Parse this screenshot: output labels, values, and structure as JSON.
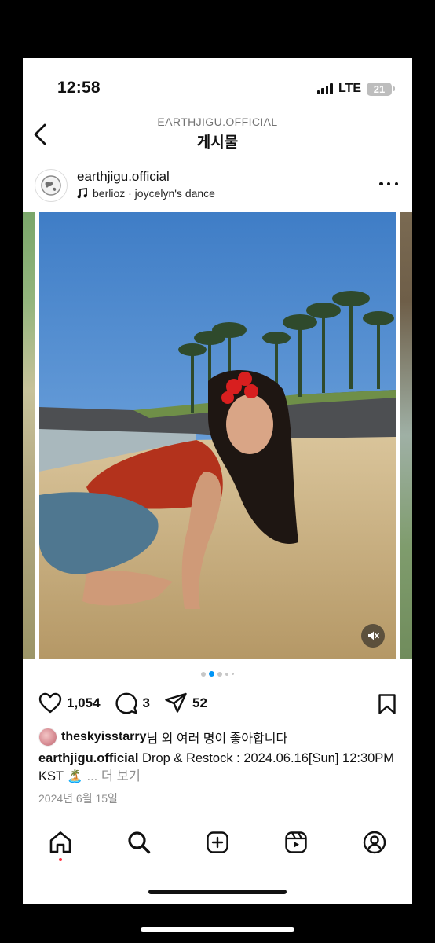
{
  "status_bar": {
    "time": "12:58",
    "network": "LTE",
    "battery": "21"
  },
  "header": {
    "subtitle": "EARTHJIGU.OFFICIAL",
    "title": "게시물"
  },
  "post": {
    "username": "earthjigu.official",
    "music": "berlioz · joycelyn's dance",
    "carousel": {
      "current_index": 1,
      "total": 5
    }
  },
  "actions": {
    "likes": "1,054",
    "comments": "3",
    "shares": "52"
  },
  "liked_by": {
    "user": "theskyisstarry",
    "text": "님 외 여러 명이 좋아합니다"
  },
  "caption": {
    "user": "earthjigu.official",
    "text": "Drop & Restock : 2024.06.16[Sun] 12:30PM KST 🏝️",
    "more": "... 더 보기"
  },
  "date": "2024년 6월 15일",
  "nav": {
    "active": "home",
    "items": [
      "home",
      "search",
      "create",
      "reels",
      "profile"
    ]
  },
  "colors": {
    "notification_dot": "#ff3040",
    "muted_text": "#8e8e8e"
  }
}
